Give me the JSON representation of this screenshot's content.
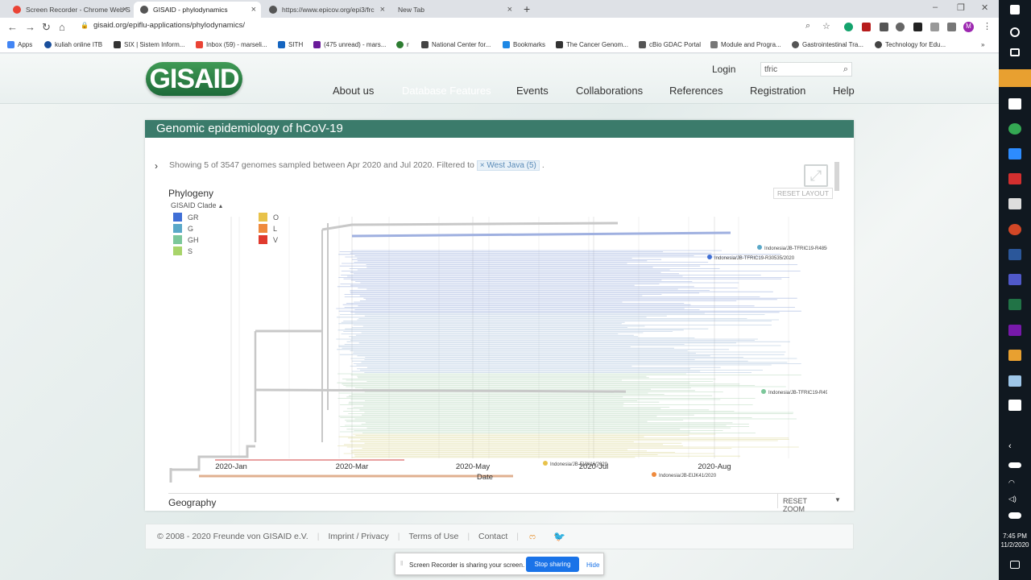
{
  "browser": {
    "tabs": [
      {
        "title": "Screen Recorder - Chrome Web S",
        "active": false,
        "favicon": "#ea4335"
      },
      {
        "title": "GISAID - phylodynamics",
        "active": true,
        "favicon": "#555555"
      },
      {
        "title": "https://www.epicov.org/epi3/frc",
        "active": false,
        "favicon": "#555555"
      },
      {
        "title": "New Tab",
        "active": false,
        "favicon": ""
      }
    ],
    "url": "gisaid.org/epiflu-applications/phylodynamics/",
    "profile_initial": "M",
    "bookmarks": [
      {
        "label": "Apps",
        "color": "#4285f4"
      },
      {
        "label": "kuliah online ITB",
        "color": "#1a4f9c"
      },
      {
        "label": "SIX | Sistem Inform...",
        "color": "#333333"
      },
      {
        "label": "Inbox (59) - marseli...",
        "color": "#ea4335"
      },
      {
        "label": "SITH",
        "color": "#1565c0"
      },
      {
        "label": "(475 unread) - mars...",
        "color": "#6a1b9a"
      },
      {
        "label": "r",
        "color": "#2e7d32"
      },
      {
        "label": "National Center for...",
        "color": "#444444"
      },
      {
        "label": "Bookmarks",
        "color": "#1e88e5"
      },
      {
        "label": "The Cancer Genom...",
        "color": "#333333"
      },
      {
        "label": "cBio GDAC Portal",
        "color": "#555555"
      },
      {
        "label": "Module and Progra...",
        "color": "#777777"
      },
      {
        "label": "Gastrointestinal Tra...",
        "color": "#555555"
      },
      {
        "label": "Technology for Edu...",
        "color": "#444444"
      }
    ]
  },
  "taskbar": {
    "time": "7:45 PM",
    "date": "11/2/2020"
  },
  "site": {
    "logo": "GISAID",
    "login": "Login",
    "search_value": "tfric",
    "nav": [
      "About us",
      "Database Features",
      "Events",
      "Collaborations",
      "References",
      "Registration",
      "Help"
    ],
    "nav_active": "Database Features"
  },
  "panel": {
    "title": "Genomic epidemiology of hCoV-19",
    "filter_text": "Showing 5 of 3547 genomes sampled between Apr 2020 and Jul 2020. Filtered to",
    "filter_chip": "× West Java (5)",
    "filter_end": ".",
    "reset_layout": "RESET LAYOUT",
    "phylogeny_title": "Phylogeny",
    "clade_title": "GISAID Clade",
    "geography_title": "Geography",
    "reset_zoom": "RESET ZOOM"
  },
  "chart_data": {
    "type": "scatter",
    "title": "Phylogeny",
    "xlabel": "Date",
    "ylabel": "",
    "x_ticks": [
      "2020-Jan",
      "2020-Mar",
      "2020-May",
      "2020-Jul",
      "2020-Aug"
    ],
    "legend_title": "GISAID Clade",
    "legend": [
      {
        "name": "GR",
        "color": "#3f6fd6"
      },
      {
        "name": "G",
        "color": "#5aa8c8"
      },
      {
        "name": "GH",
        "color": "#7cc79a"
      },
      {
        "name": "S",
        "color": "#a8d46a"
      },
      {
        "name": "O",
        "color": "#e8c24a"
      },
      {
        "name": "L",
        "color": "#ef8a3d"
      },
      {
        "name": "V",
        "color": "#e03a2e"
      }
    ],
    "highlighted_tips": [
      {
        "label": "Indonesia/JB-TFRIC19-R48562/2020",
        "clade": "G",
        "date": "2020-Jul"
      },
      {
        "label": "Indonesia/JB-TFRIC19-R30535/2020",
        "clade": "GR",
        "date": "2020-Jun"
      },
      {
        "label": "Indonesia/JB-TFRIC19-R49542/2020",
        "clade": "GH",
        "date": "2020-Jul"
      },
      {
        "label": "Indonesia/JB-EIJK16/2020",
        "clade": "O",
        "date": "2020-Apr"
      },
      {
        "label": "Indonesia/JB-EIJK41/2020",
        "clade": "L",
        "date": "2020-Jun"
      }
    ]
  },
  "footer": {
    "copyright": "© 2008 - 2020   Freunde von GISAID e.V.",
    "imprint": "Imprint / Privacy",
    "terms": "Terms of Use",
    "contact": "Contact"
  },
  "share_bar": {
    "text": "Screen Recorder is sharing your screen.",
    "stop": "Stop sharing",
    "hide": "Hide"
  }
}
